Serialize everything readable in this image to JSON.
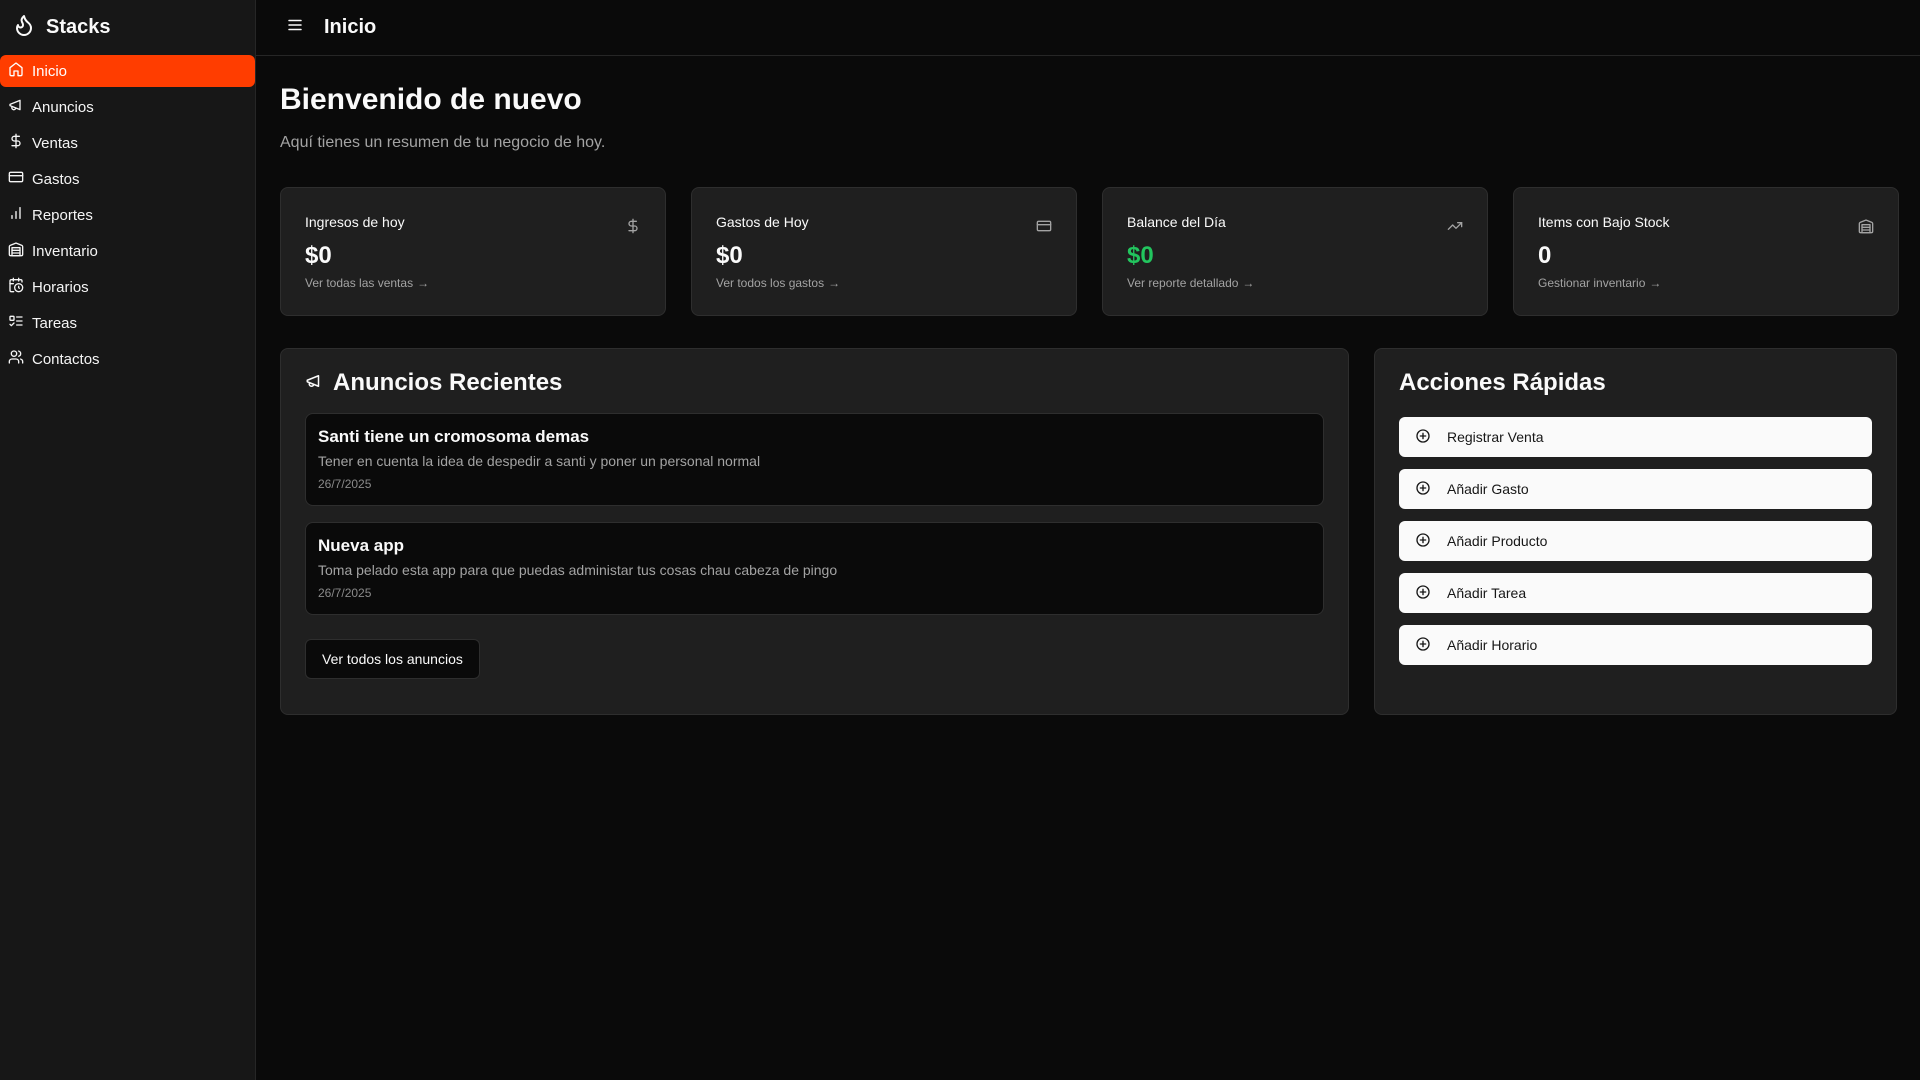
{
  "app": {
    "name": "Stacks"
  },
  "sidebar": {
    "items": [
      {
        "label": "Inicio",
        "icon": "home-icon",
        "active": true
      },
      {
        "label": "Anuncios",
        "icon": "megaphone-icon"
      },
      {
        "label": "Ventas",
        "icon": "dollar-icon"
      },
      {
        "label": "Gastos",
        "icon": "credit-card-icon"
      },
      {
        "label": "Reportes",
        "icon": "bar-chart-icon"
      },
      {
        "label": "Inventario",
        "icon": "warehouse-icon"
      },
      {
        "label": "Horarios",
        "icon": "calendar-clock-icon"
      },
      {
        "label": "Tareas",
        "icon": "list-checks-icon"
      },
      {
        "label": "Contactos",
        "icon": "users-icon"
      }
    ]
  },
  "header": {
    "title": "Inicio"
  },
  "main": {
    "welcome": "Bienvenido de nuevo",
    "subtitle": "Aquí tienes un resumen de tu negocio de hoy."
  },
  "stats": [
    {
      "label": "Ingresos de hoy",
      "value": "$0",
      "link": "Ver todas las ventas",
      "icon": "dollar-icon"
    },
    {
      "label": "Gastos de Hoy",
      "value": "$0",
      "link": "Ver todos los gastos",
      "icon": "credit-card-icon"
    },
    {
      "label": "Balance del Día",
      "value": "$0",
      "link": "Ver reporte detallado",
      "icon": "trending-up-icon",
      "value_color": "#22c55e"
    },
    {
      "label": "Items con Bajo Stock",
      "value": "0",
      "link": "Gestionar inventario",
      "icon": "warehouse-icon"
    }
  ],
  "announcements": {
    "title": "Anuncios Recientes",
    "items": [
      {
        "title": "Santi tiene un cromosoma demas",
        "body": "Tener en cuenta la idea de despedir a santi y poner un personal normal",
        "date": "26/7/2025"
      },
      {
        "title": "Nueva app",
        "body": "Toma pelado esta app para que puedas administar tus cosas chau cabeza de pingo",
        "date": "26/7/2025"
      }
    ],
    "view_all": "Ver todos los anuncios"
  },
  "quick_actions": {
    "title": "Acciones Rápidas",
    "items": [
      {
        "label": "Registrar Venta"
      },
      {
        "label": "Añadir Gasto"
      },
      {
        "label": "Añadir Producto"
      },
      {
        "label": "Añadir Tarea"
      },
      {
        "label": "Añadir Horario"
      }
    ]
  },
  "colors": {
    "accent": "#ff3d00",
    "positive": "#22c55e",
    "background": "#0a0a0a",
    "card": "#1f1f1f"
  }
}
